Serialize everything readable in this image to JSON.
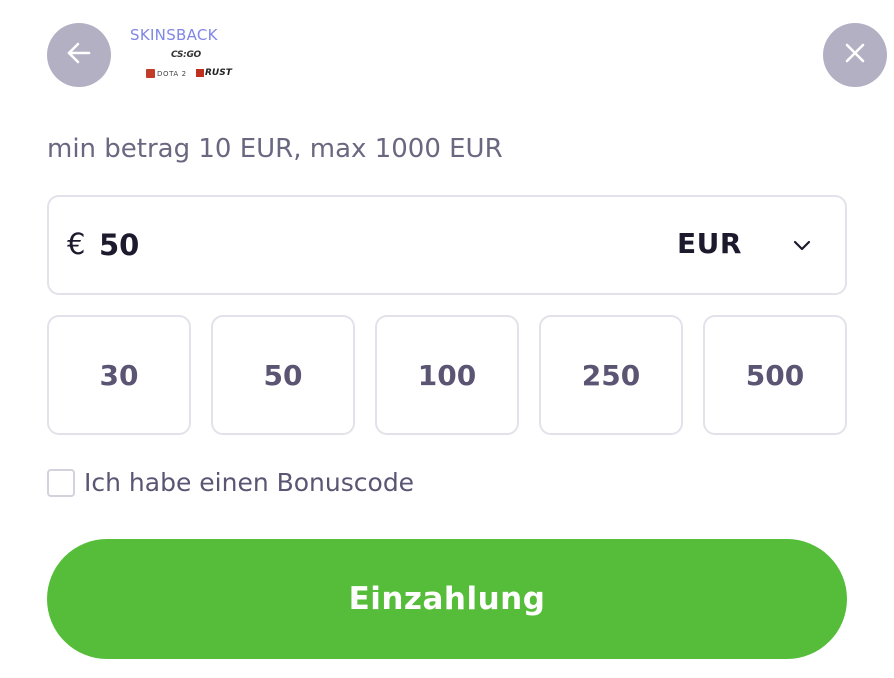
{
  "header": {
    "back_icon": "arrow-left-icon",
    "close_icon": "close-icon",
    "logo": {
      "brand": "SKINSBACK",
      "games": [
        "CS:GO",
        "DOTA 2",
        "RUST"
      ]
    }
  },
  "limits_text": "min betrag 10 EUR, max 1000 EUR",
  "amount": {
    "currency_symbol": "€",
    "value": "50",
    "currency": "EUR",
    "dropdown_icon": "chevron-down-icon"
  },
  "presets": [
    "30",
    "50",
    "100",
    "250",
    "500"
  ],
  "bonus": {
    "label": "Ich habe einen Bonuscode",
    "checked": false
  },
  "submit_label": "Einzahlung",
  "colors": {
    "accent_green": "#56bd3a",
    "circle_button": "#b3b0c4",
    "brand_blue": "#7f86e6"
  }
}
